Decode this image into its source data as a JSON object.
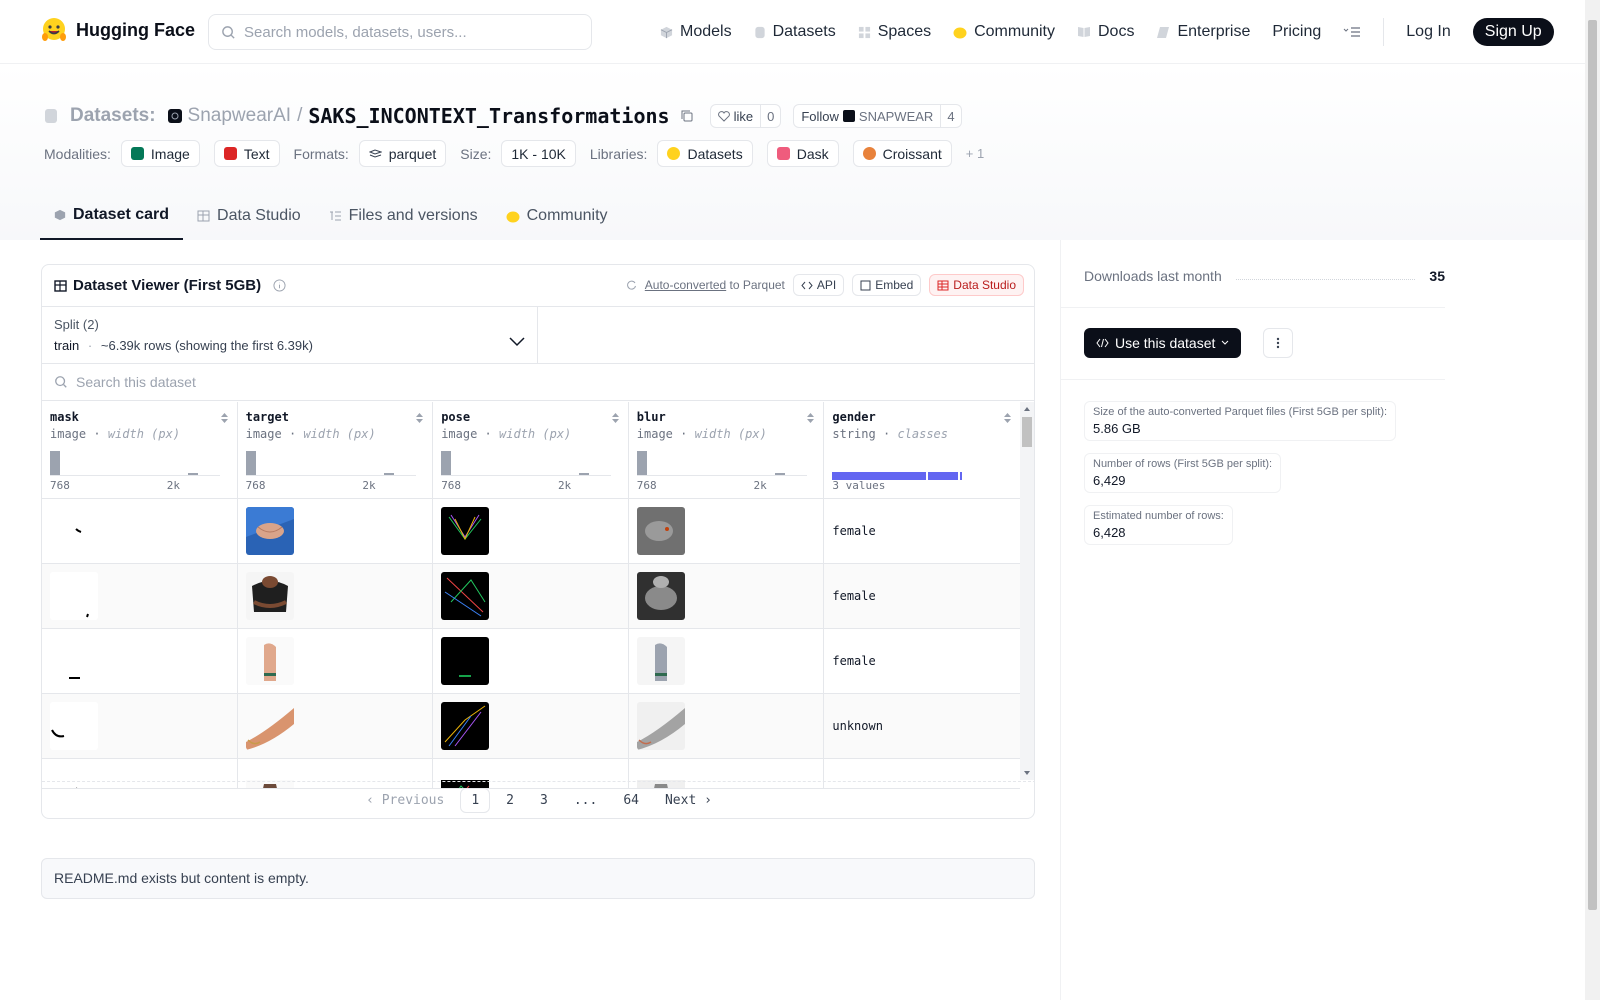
{
  "header": {
    "brand": "Hugging Face",
    "search_placeholder": "Search models, datasets, users...",
    "nav": [
      {
        "label": "Models",
        "icon": "cube-icon"
      },
      {
        "label": "Datasets",
        "icon": "database-icon"
      },
      {
        "label": "Spaces",
        "icon": "grid-icon"
      },
      {
        "label": "Community",
        "icon": "hug-icon"
      },
      {
        "label": "Docs",
        "icon": "book-icon"
      },
      {
        "label": "Enterprise",
        "icon": "enterprise-icon"
      },
      {
        "label": "Pricing"
      }
    ],
    "login": "Log In",
    "signup": "Sign Up"
  },
  "repo": {
    "section": "Datasets:",
    "owner": "SnapwearAI",
    "separator": "/",
    "name": "SAKS_INCONTEXT_Transformations",
    "like_label": "like",
    "like_count": "0",
    "follow_label": "Follow",
    "follow_org": "SNAPWEAR",
    "follow_count": "4"
  },
  "tags": {
    "modalities_label": "Modalities:",
    "modalities": [
      "Image",
      "Text"
    ],
    "formats_label": "Formats:",
    "format": "parquet",
    "size_label": "Size:",
    "size": "1K - 10K",
    "libraries_label": "Libraries:",
    "libraries": [
      "Datasets",
      "Dask",
      "Croissant"
    ],
    "more": "+ 1"
  },
  "tabs": [
    "Dataset card",
    "Data Studio",
    "Files and versions",
    "Community"
  ],
  "viewer": {
    "title": "Dataset Viewer (First 5GB)",
    "auto_converted": "Auto-converted",
    "to_parquet": " to Parquet",
    "api": "API",
    "embed": "Embed",
    "data_studio": "Data Studio",
    "split_label": "Split (2)",
    "split_name": "train",
    "split_dot": "·",
    "split_rows": "~6.39k rows (showing the first 6.39k)",
    "search_placeholder": "Search this dataset",
    "columns": [
      {
        "name": "mask",
        "type": "image",
        "sub": "width (px)",
        "min": "768",
        "max": "2k"
      },
      {
        "name": "target",
        "type": "image",
        "sub": "width (px)",
        "min": "768",
        "max": "2k"
      },
      {
        "name": "pose",
        "type": "image",
        "sub": "width (px)",
        "min": "768",
        "max": "2k"
      },
      {
        "name": "blur",
        "type": "image",
        "sub": "width (px)",
        "min": "768",
        "max": "2k"
      },
      {
        "name": "gender",
        "type": "string",
        "sub": "classes",
        "values_label": "3 values"
      }
    ],
    "separator": "·",
    "gender_values": [
      "female",
      "female",
      "female",
      "unknown",
      ""
    ],
    "pager": {
      "prev": "Previous",
      "pages": [
        "1",
        "2",
        "3",
        "...",
        "64"
      ],
      "next": "Next"
    }
  },
  "readme": "README.md exists but content is empty.",
  "sidebar": {
    "downloads_label": "Downloads last month",
    "downloads": "35",
    "use_button": "Use this dataset",
    "stats": [
      {
        "label": "Size of the auto-converted Parquet files (First 5GB per split):",
        "value": "5.86 GB"
      },
      {
        "label": "Number of rows (First 5GB per split):",
        "value": "6,429"
      },
      {
        "label": "Estimated number of rows:",
        "value": "6,428"
      }
    ]
  }
}
